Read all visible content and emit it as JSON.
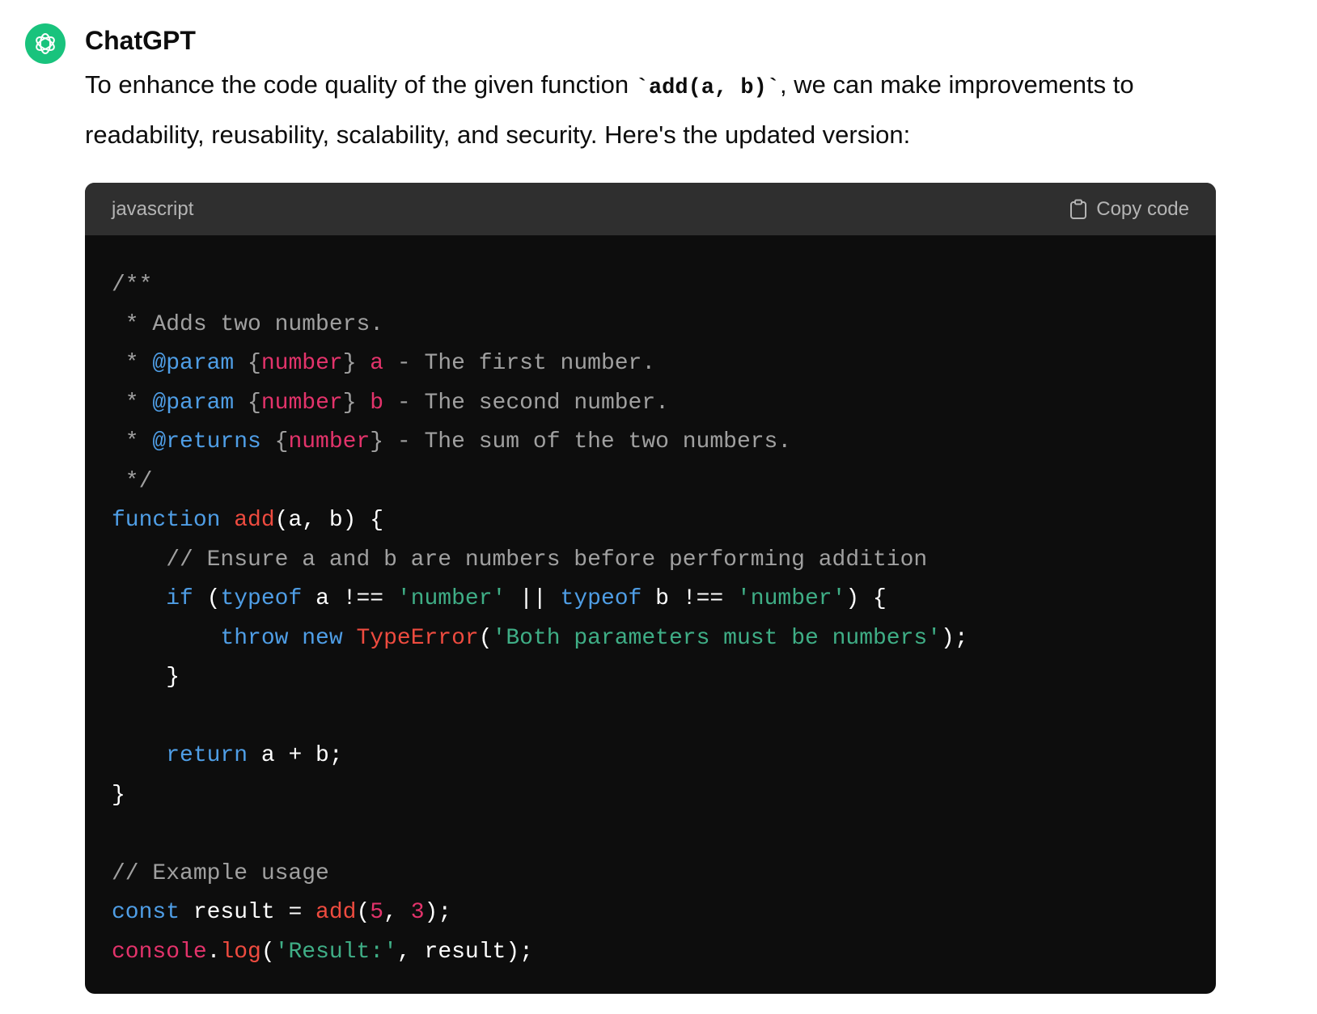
{
  "author": "ChatGPT",
  "avatar_icon": "openai-logo-icon",
  "message": {
    "intro": "To enhance the code quality of the given function ",
    "code_inline": "`add(a, b)`",
    "outro": ", we can make improvements to readability, reusability, scalability, and security. Here's the updated version:"
  },
  "code_block": {
    "language": "javascript",
    "copy_label": "Copy code",
    "copy_icon": "clipboard-icon",
    "lines": [
      [
        [
          "c",
          "/**"
        ]
      ],
      [
        [
          "c",
          " * Adds two numbers."
        ]
      ],
      [
        [
          "c",
          " * "
        ],
        [
          "tag",
          "@param"
        ],
        [
          "c",
          " {"
        ],
        [
          "type",
          "number"
        ],
        [
          "c",
          "} "
        ],
        [
          "type",
          "a"
        ],
        [
          "c",
          " - The first number."
        ]
      ],
      [
        [
          "c",
          " * "
        ],
        [
          "tag",
          "@param"
        ],
        [
          "c",
          " {"
        ],
        [
          "type",
          "number"
        ],
        [
          "c",
          "} "
        ],
        [
          "type",
          "b"
        ],
        [
          "c",
          " - The second number."
        ]
      ],
      [
        [
          "c",
          " * "
        ],
        [
          "tag",
          "@returns"
        ],
        [
          "c",
          " {"
        ],
        [
          "type",
          "number"
        ],
        [
          "c",
          "} - The sum of the two numbers."
        ]
      ],
      [
        [
          "c",
          " */"
        ]
      ],
      [
        [
          "k",
          "function"
        ],
        [
          "p",
          " "
        ],
        [
          "f",
          "add"
        ],
        [
          "p",
          "(a, b) {"
        ]
      ],
      [
        [
          "p",
          "    "
        ],
        [
          "c",
          "// Ensure a and b are numbers before performing addition"
        ]
      ],
      [
        [
          "p",
          "    "
        ],
        [
          "k",
          "if"
        ],
        [
          "p",
          " ("
        ],
        [
          "k",
          "typeof"
        ],
        [
          "p",
          " a !== "
        ],
        [
          "s",
          "'number'"
        ],
        [
          "p",
          " || "
        ],
        [
          "k",
          "typeof"
        ],
        [
          "p",
          " b !== "
        ],
        [
          "s",
          "'number'"
        ],
        [
          "p",
          ") {"
        ]
      ],
      [
        [
          "p",
          "        "
        ],
        [
          "k",
          "throw"
        ],
        [
          "p",
          " "
        ],
        [
          "k",
          "new"
        ],
        [
          "p",
          " "
        ],
        [
          "f",
          "TypeError"
        ],
        [
          "p",
          "("
        ],
        [
          "s",
          "'Both parameters must be numbers'"
        ],
        [
          "p",
          ");"
        ]
      ],
      [
        [
          "p",
          "    }"
        ]
      ],
      [
        [
          "p",
          ""
        ]
      ],
      [
        [
          "p",
          "    "
        ],
        [
          "k",
          "return"
        ],
        [
          "p",
          " a + b;"
        ]
      ],
      [
        [
          "p",
          "}"
        ]
      ],
      [
        [
          "p",
          ""
        ]
      ],
      [
        [
          "c",
          "// Example usage"
        ]
      ],
      [
        [
          "k",
          "const"
        ],
        [
          "p",
          " result = "
        ],
        [
          "f",
          "add"
        ],
        [
          "p",
          "("
        ],
        [
          "n",
          "5"
        ],
        [
          "p",
          ", "
        ],
        [
          "n",
          "3"
        ],
        [
          "p",
          ");"
        ]
      ],
      [
        [
          "b",
          "console"
        ],
        [
          "p",
          "."
        ],
        [
          "f",
          "log"
        ],
        [
          "p",
          "("
        ],
        [
          "s",
          "'Result:'"
        ],
        [
          "p",
          ", result);"
        ]
      ]
    ]
  },
  "colors": {
    "avatar_bg": "#19c37d",
    "code_bg": "#0d0d0d",
    "code_header_bg": "#2f2f2f",
    "comment": "#a0a0a0",
    "keyword": "#4f9ee6",
    "type": "#e3336b",
    "function": "#ee4b3f",
    "string": "#3fae86"
  }
}
